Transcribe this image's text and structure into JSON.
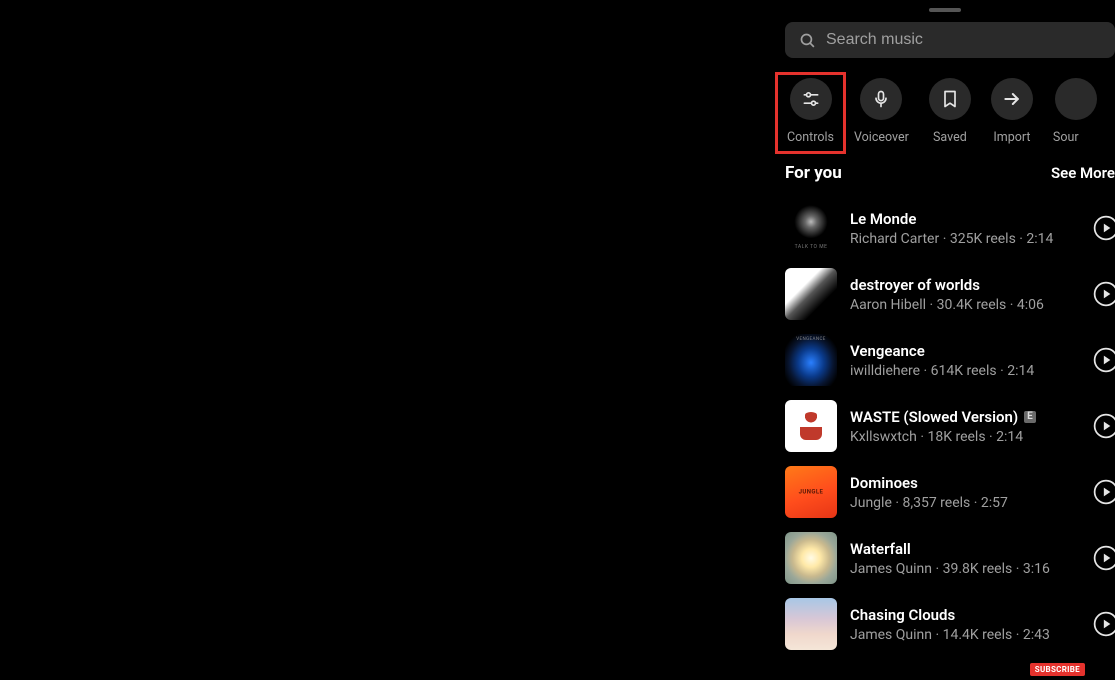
{
  "search": {
    "placeholder": "Search music"
  },
  "actions": [
    {
      "label": "Controls",
      "highlighted": true
    },
    {
      "label": "Voiceover"
    },
    {
      "label": "Saved"
    },
    {
      "label": "Import"
    },
    {
      "label": "Sour"
    }
  ],
  "section": {
    "title": "For you",
    "see_more": "See More"
  },
  "tracks": [
    {
      "title": "Le Monde",
      "artist": "Richard Carter",
      "reels": "325K reels",
      "duration": "2:14",
      "explicit": false
    },
    {
      "title": "destroyer of worlds",
      "artist": "Aaron Hibell",
      "reels": "30.4K reels",
      "duration": "4:06",
      "explicit": false
    },
    {
      "title": "Vengeance",
      "artist": "iwilldiehere",
      "reels": "614K reels",
      "duration": "2:14",
      "explicit": false
    },
    {
      "title": "WASTE (Slowed Version)",
      "artist": "Kxllswxtch",
      "reels": "18K reels",
      "duration": "2:14",
      "explicit": true
    },
    {
      "title": "Dominoes",
      "artist": "Jungle",
      "reels": "8,357 reels",
      "duration": "2:57",
      "explicit": false
    },
    {
      "title": "Waterfall",
      "artist": "James Quinn",
      "reels": "39.8K reels",
      "duration": "3:16",
      "explicit": false
    },
    {
      "title": "Chasing Clouds",
      "artist": "James Quinn",
      "reels": "14.4K reels",
      "duration": "2:43",
      "explicit": false
    }
  ],
  "subscribe_label": "SUBSCRIBE",
  "explicit_label": "E"
}
